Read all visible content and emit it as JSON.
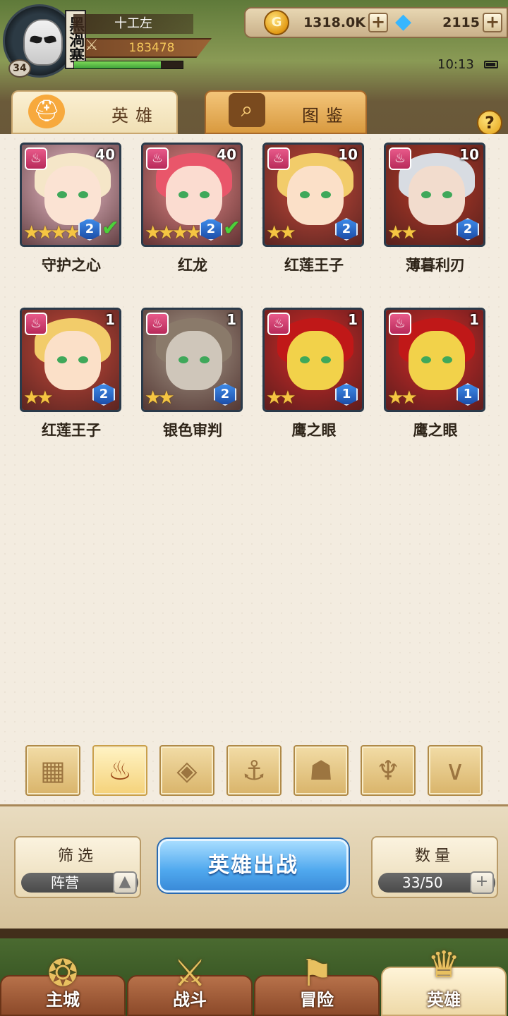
{
  "player": {
    "name": "十工左",
    "guild_tag": "黑渦塞",
    "level": "34",
    "power": "183478",
    "exp_fraction": 0.8
  },
  "currency": {
    "gold": "1318.0K",
    "gems": "2115",
    "plus_symbol": "+"
  },
  "status": {
    "time": "10:13"
  },
  "tabs": [
    {
      "label": "英雄",
      "icon": "knight-helmet-icon"
    },
    {
      "label": "图鉴",
      "icon": "magnifier-book-icon"
    }
  ],
  "help_symbol": "?",
  "heroes": [
    {
      "name": "守护之心",
      "level": "40",
      "stars": 4,
      "tier": "2",
      "checked": true,
      "palette": {
        "bg": "#f2c4d0",
        "hair": "#f5e6c8",
        "skin": "#fbe3d3"
      }
    },
    {
      "name": "红龙",
      "level": "40",
      "stars": 4,
      "tier": "2",
      "checked": true,
      "palette": {
        "bg": "#e88a8a",
        "hair": "#e9566a",
        "skin": "#fbdcd0"
      }
    },
    {
      "name": "红莲王子",
      "level": "10",
      "stars": 2,
      "tier": "2",
      "checked": false,
      "palette": {
        "bg": "#c94a3a",
        "hair": "#f2cc6a",
        "skin": "#fbe0c8"
      }
    },
    {
      "name": "薄暮利刃",
      "level": "10",
      "stars": 2,
      "tier": "2",
      "checked": false,
      "palette": {
        "bg": "#b83a28",
        "hair": "#d8dce2",
        "skin": "#f2dccd"
      }
    },
    {
      "name": "红莲王子",
      "level": "1",
      "stars": 2,
      "tier": "2",
      "checked": false,
      "palette": {
        "bg": "#c94a3a",
        "hair": "#f2cc6a",
        "skin": "#fbe0c8"
      }
    },
    {
      "name": "银色审判",
      "level": "1",
      "stars": 2,
      "tier": "2",
      "checked": false,
      "palette": {
        "bg": "#a89a8a",
        "hair": "#8a7a6a",
        "skin": "#cfc6ba"
      }
    },
    {
      "name": "鹰之眼",
      "level": "1",
      "stars": 2,
      "tier": "1",
      "checked": false,
      "palette": {
        "bg": "#d42a28",
        "hair": "#c01818",
        "skin": "#f2d24a"
      }
    },
    {
      "name": "鹰之眼",
      "level": "1",
      "stars": 2,
      "tier": "1",
      "checked": false,
      "palette": {
        "bg": "#d42a28",
        "hair": "#c01818",
        "skin": "#f2d24a"
      }
    }
  ],
  "class_filters": [
    {
      "icon": "grid-all-icon",
      "glyph": "▦",
      "active": false
    },
    {
      "icon": "flame-crest-icon",
      "glyph": "♨",
      "active": true
    },
    {
      "icon": "diamond-crest-icon",
      "glyph": "◈",
      "active": false
    },
    {
      "icon": "anchor-icon",
      "glyph": "⚓",
      "active": false
    },
    {
      "icon": "beast-head-icon",
      "glyph": "☗",
      "active": false
    },
    {
      "icon": "demon-horns-icon",
      "glyph": "♆",
      "active": false
    },
    {
      "icon": "wings-icon",
      "glyph": "∨",
      "active": false
    }
  ],
  "filter_box": {
    "title": "筛选",
    "value": "阵营",
    "toggle_symbol": "▲"
  },
  "deploy_button": "英雄出战",
  "count_box": {
    "title": "数量",
    "value": "33/50",
    "plus_symbol": "+"
  },
  "nav": [
    {
      "label": "主城",
      "icon": "castle-gem-icon",
      "glyph": "❂",
      "active": false
    },
    {
      "label": "战斗",
      "icon": "crossed-swords-icon",
      "glyph": "⚔",
      "active": false
    },
    {
      "label": "冒险",
      "icon": "map-scroll-icon",
      "glyph": "⚑",
      "active": false
    },
    {
      "label": "英雄",
      "icon": "hero-crest-icon",
      "glyph": "♛",
      "active": true
    }
  ]
}
